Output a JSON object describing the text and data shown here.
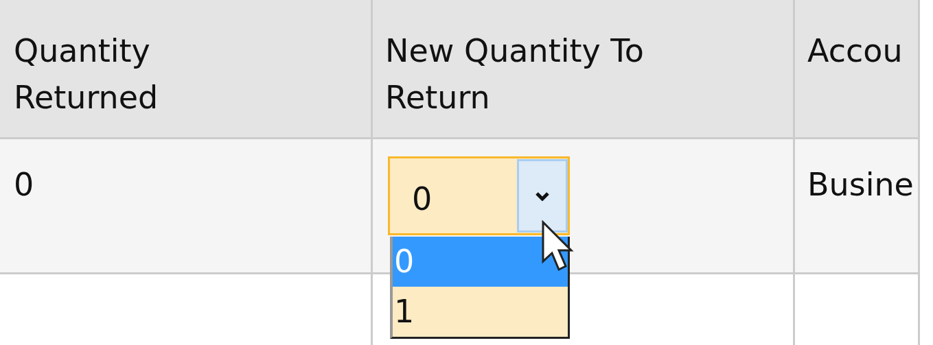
{
  "table": {
    "columns": [
      {
        "label": "Quantity Returned"
      },
      {
        "label": "New Quantity To Return"
      },
      {
        "label": "Accou"
      }
    ],
    "rows": [
      {
        "quantity_returned": "0",
        "new_quantity": {
          "value": "0",
          "expanded": true,
          "options": [
            {
              "label": "0",
              "selected": true
            },
            {
              "label": "1",
              "selected": false
            }
          ]
        },
        "column_3": "Busine"
      }
    ]
  }
}
